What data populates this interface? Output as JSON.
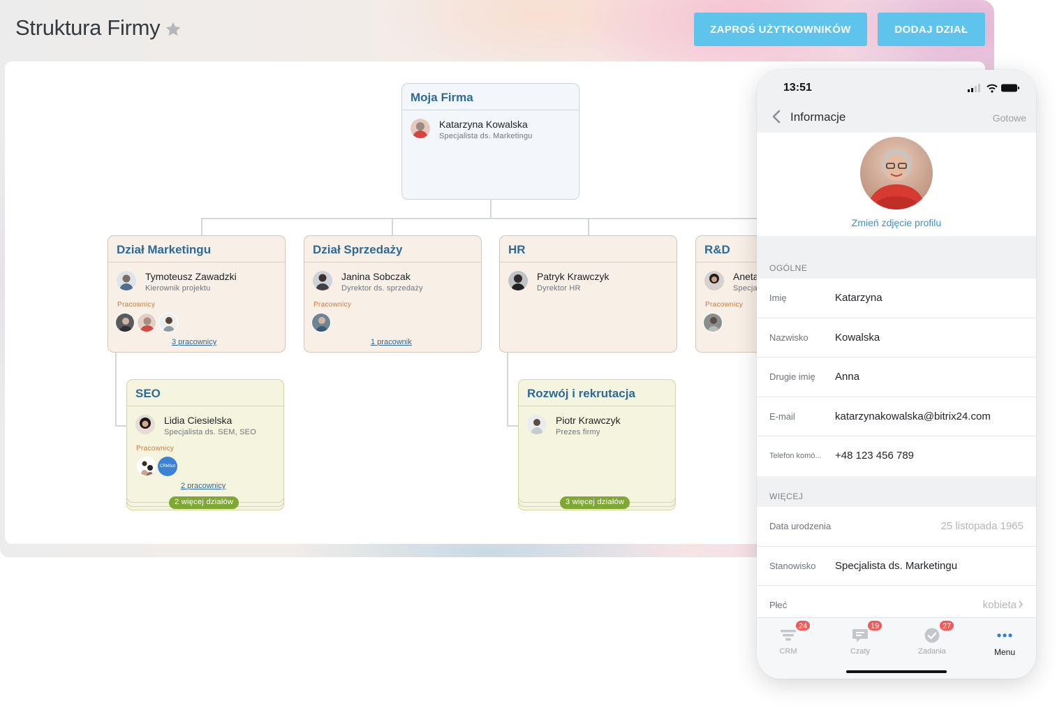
{
  "desktop": {
    "title": "Struktura Firmy",
    "buttons": {
      "invite": "ZAPROŚ UŻYTKOWNIKÓW",
      "add_department": "DODAJ DZIAŁ"
    },
    "accent_color": "#5fc4ec"
  },
  "org": {
    "root": {
      "title": "Moja Firma",
      "head_name": "Katarzyna Kowalska",
      "head_role": "Specjalista ds. Marketingu"
    },
    "departments": [
      {
        "title": "Dział Marketingu",
        "head_name": "Tymoteusz Zawadzki",
        "head_role": "Kierownik projektu",
        "employees_label": "Pracownicy",
        "employees_link": "3 pracownicy"
      },
      {
        "title": "Dział Sprzedaży",
        "head_name": "Janina Sobczak",
        "head_role": "Dyrektor ds. sprzedaży",
        "employees_label": "Pracownicy",
        "employees_link": "1 pracownik"
      },
      {
        "title": "HR",
        "head_name": "Patryk Krawczyk",
        "head_role": "Dyrektor HR"
      },
      {
        "title": "R&D",
        "head_name": "Aneta",
        "head_role": "Specja",
        "employees_label": "Pracownicy"
      }
    ],
    "subdepartments": [
      {
        "title": "SEO",
        "head_name": "Lidia Ciesielska",
        "head_role": "Specjalista ds. SEM, SEO",
        "employees_label": "Pracownicy",
        "employees_link": "2 pracownicy",
        "bot_label": "CRMbot",
        "more": "2 więcej działów"
      },
      {
        "title": "Rozwój i rekrutacja",
        "head_name": "Piotr Krawczyk",
        "head_role": "Prezes firmy",
        "more": "3 więcej działów"
      }
    ]
  },
  "phone": {
    "time": "13:51",
    "nav_title": "Informacje",
    "done": "Gotowe",
    "change_photo": "Zmień zdjęcie profilu",
    "sections": {
      "general": {
        "title": "OGÓLNE",
        "fields": [
          {
            "label": "Imię",
            "value": "Katarzyna"
          },
          {
            "label": "Nazwisko",
            "value": "Kowalska"
          },
          {
            "label": "Drugie imię",
            "value": "Anna"
          },
          {
            "label": "E-mail",
            "value": "katarzynakowalska@bitrix24.com"
          },
          {
            "label": "Telefon komó...",
            "value": "+48 123 456 789"
          }
        ]
      },
      "more": {
        "title": "WIĘCEJ",
        "fields": [
          {
            "label": "Data urodzenia",
            "value": "25 listopada 1965"
          },
          {
            "label": "Stanowisko",
            "value": "Specjalista ds. Marketingu"
          },
          {
            "label": "Płeć",
            "value": "kobieta"
          }
        ]
      }
    },
    "tabs": [
      {
        "label": "CRM",
        "badge": "24",
        "icon": "funnel-icon"
      },
      {
        "label": "Czaty",
        "badge": "19",
        "icon": "chat-icon"
      },
      {
        "label": "Zadania",
        "badge": "27",
        "icon": "check-circle-icon"
      },
      {
        "label": "Menu",
        "icon": "more-dots-icon"
      }
    ]
  }
}
